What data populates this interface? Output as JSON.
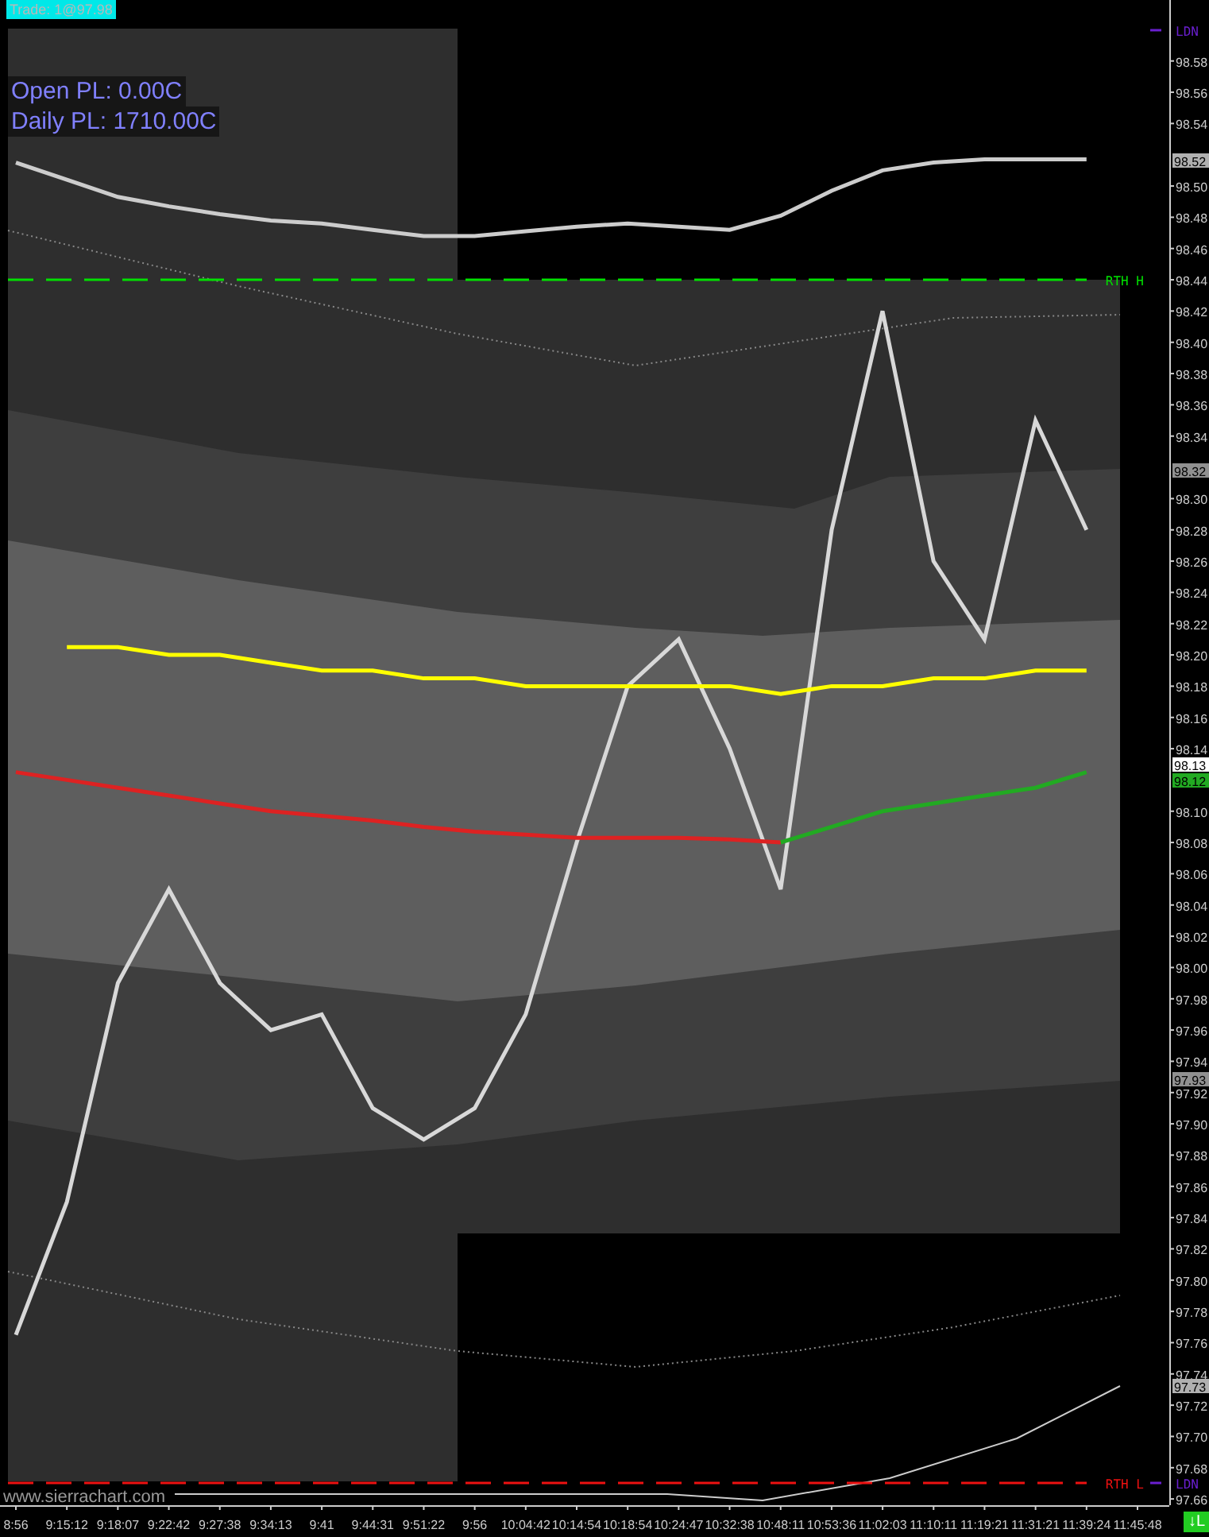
{
  "trade_label": "Trade: 1@97.98",
  "pl_lines": [
    {
      "label": "Open PL: 0.00C"
    },
    {
      "label": "Daily PL: 1710.00C"
    }
  ],
  "chart": {
    "chart_data": {
      "type": "line",
      "categories": [
        "8:56",
        "9:15:12",
        "9:18:07",
        "9:22:42",
        "9:27:38",
        "9:34:13",
        "9:41",
        "9:44:31",
        "9:51:22",
        "9:56",
        "10:04:42",
        "10:14:54",
        "10:18:54",
        "10:24:47",
        "10:32:38",
        "10:48:11",
        "10:53:36",
        "11:02:03",
        "11:10:11",
        "11:19:21",
        "11:31:21",
        "11:39:24",
        "11:45:48"
      ],
      "ylim": [
        97.656,
        98.619
      ],
      "yticks": [
        98.58,
        98.56,
        98.54,
        {
          "value": 98.5,
          "label": "98.50"
        },
        98.48,
        98.46,
        98.44,
        98.42,
        {
          "value": 98.4,
          "label": "98.40"
        },
        98.38,
        98.36,
        98.34,
        {
          "value": 98.3,
          "label": "98.30"
        },
        98.28,
        98.26,
        98.24,
        98.22,
        {
          "value": 98.2,
          "label": "98.20"
        },
        98.18,
        98.16,
        98.14,
        {
          "value": 98.1,
          "label": "98.10"
        },
        98.08,
        98.06,
        98.04,
        98.02,
        {
          "value": 98,
          "label": "98.00"
        },
        97.98,
        97.96,
        97.94,
        97.92,
        {
          "value": 97.9,
          "label": "97.90"
        },
        97.88,
        97.86,
        97.84,
        97.82,
        {
          "value": 97.8,
          "label": "97.80"
        },
        97.78,
        97.76,
        97.74,
        97.72,
        {
          "value": 97.7,
          "label": "97.70"
        },
        97.68,
        97.66
      ],
      "series": [
        {
          "color": "#cccccc",
          "values": [
            98.515,
            98.504,
            98.493,
            98.487,
            98.482,
            98.478,
            98.476,
            98.472,
            98.468,
            98.468,
            98.471,
            98.474,
            98.476,
            98.474,
            98.472,
            98.481,
            98.497,
            98.51,
            98.515,
            98.517,
            98.517,
            98.517,
            null
          ]
        },
        {
          "color": "#d8d8d8",
          "values": [
            97.765,
            97.85,
            97.99,
            98.05,
            97.99,
            97.96,
            97.97,
            97.91,
            97.89,
            97.91,
            97.97,
            98.08,
            98.18,
            98.21,
            98.14,
            98.05,
            98.28,
            98.42,
            98.26,
            98.21,
            98.35,
            98.28,
            null
          ]
        },
        {
          "color": "#ffff00",
          "values": [
            null,
            98.205,
            98.205,
            98.2,
            98.2,
            98.195,
            98.19,
            98.19,
            98.185,
            98.185,
            98.18,
            98.18,
            98.18,
            98.18,
            98.18,
            98.175,
            98.18,
            98.18,
            98.185,
            98.185,
            98.19,
            98.19,
            null
          ]
        },
        {
          "color": "#dd2222",
          "values": [
            98.125,
            98.12,
            98.115,
            98.11,
            98.105,
            98.1,
            98.097,
            98.094,
            98.09,
            98.087,
            98.085,
            98.083,
            98.083,
            98.083,
            98.082,
            98.08,
            null,
            null,
            null,
            null,
            null,
            null,
            null
          ]
        },
        {
          "color": "#22aa22",
          "values": [
            null,
            null,
            null,
            null,
            null,
            null,
            null,
            null,
            null,
            null,
            null,
            null,
            null,
            null,
            null,
            98.08,
            98.09,
            98.1,
            98.105,
            98.11,
            98.115,
            98.125,
            null
          ]
        }
      ]
    }
  },
  "level_lines": [
    {
      "label": "LDN",
      "color": "#6a1fd0"
    },
    {
      "label": "RTH H",
      "color": "#00e000"
    },
    {
      "label": "RTH L",
      "color": "#ee1111"
    },
    {
      "label": "LDN",
      "color": "#6a1fd0"
    }
  ],
  "price_markers": [
    {
      "label": "98.52",
      "color": "#b0b0b0"
    },
    {
      "label": "98.32",
      "color": "#909090"
    },
    {
      "label": "98.13",
      "color": "#ffffff"
    },
    {
      "label": "98.12",
      "color": "#22aa22"
    },
    {
      "label": "97.93",
      "color": "#909090"
    },
    {
      "label": "97.73",
      "color": "#b0b0b0"
    }
  ],
  "chart_label": "www.sierrachart.com",
  "status_badge": "↓L"
}
